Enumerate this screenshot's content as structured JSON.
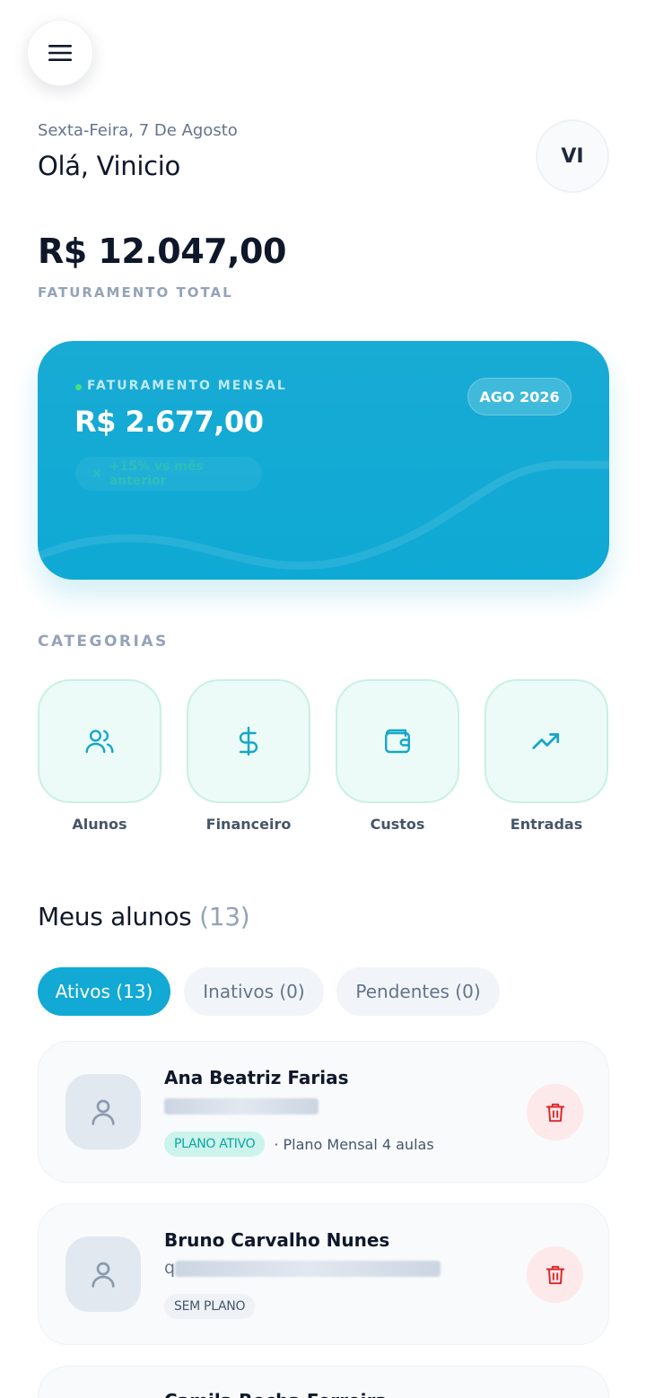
{
  "header": {
    "date": "Sexta-Feira, 7 De Agosto",
    "greeting": "Olá, Vinicio",
    "avatar_initials": "VI"
  },
  "summary": {
    "total_value": "R$ 12.047,00",
    "total_label": "FATURAMENTO TOTAL"
  },
  "revenue_card": {
    "label": "FATURAMENTO MENSAL",
    "value": "R$ 2.677,00",
    "period": "AGO 2026",
    "trend": "+15% vs mês anterior",
    "colors": {
      "card": "#12a9d4",
      "dot": "#4ade80"
    }
  },
  "categories": {
    "title": "CATEGORIAS",
    "items": [
      {
        "label": "Alunos",
        "icon": "users-icon"
      },
      {
        "label": "Financeiro",
        "icon": "dollar-icon"
      },
      {
        "label": "Custos",
        "icon": "wallet-icon"
      },
      {
        "label": "Entradas",
        "icon": "trending-up-icon"
      }
    ]
  },
  "students": {
    "title": "Meus alunos",
    "count": "(13)",
    "tabs": [
      {
        "label": "Ativos (13)",
        "active": true
      },
      {
        "label": "Inativos (0)",
        "active": false
      },
      {
        "label": "Pendentes (0)",
        "active": false
      }
    ],
    "list": [
      {
        "name": "Ana Beatriz Farias",
        "email_prefix": "",
        "plan_badge": "PLANO ATIVO",
        "plan_name": "· Plano Mensal 4 aulas"
      },
      {
        "name": "Bruno Carvalho Nunes",
        "email_prefix": "q",
        "plan_badge": "SEM PLANO",
        "plan_name": ""
      },
      {
        "name": "Camila Rocha Ferreira"
      }
    ]
  }
}
